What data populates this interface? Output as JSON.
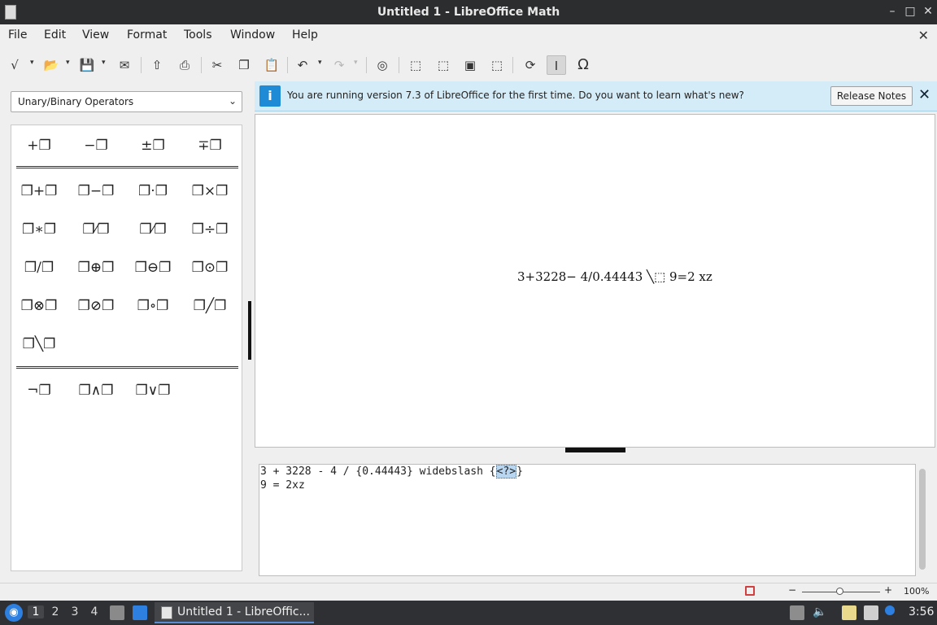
{
  "window": {
    "title": "Untitled 1 - LibreOffice Math",
    "min_glyph": "–",
    "max_glyph": "□",
    "close_glyph": "✕",
    "doc_close_glyph": "✕"
  },
  "menu": [
    "File",
    "Edit",
    "View",
    "Format",
    "Tools",
    "Window",
    "Help"
  ],
  "toolbar": {
    "icons": [
      "formula-cursor-icon",
      "open-icon",
      "save-icon",
      "export-icon",
      "print-icon",
      "cut-icon",
      "copy-icon",
      "paste-icon",
      "undo-icon",
      "redo-icon",
      "zoom-in-icon",
      "zoom-out-icon",
      "show-all-icon",
      "update-icon",
      "formula-cursor-toggle-icon",
      "symbols-icon"
    ],
    "glyphs": {
      "new": "√",
      "open": "📂",
      "save": "💾",
      "export": "✉",
      "pdf": "⇧",
      "print": "⎙",
      "cut": "✂",
      "copy": "❐",
      "paste": "📋",
      "undo": "↶",
      "redo": "↷",
      "zoom100": "◎",
      "zoomin": "⬚",
      "zoomout": "⬚",
      "showall": "▣",
      "fit": "⬚",
      "update": "⟳",
      "cursor": "I",
      "symbols": "Ω",
      "dropdown": "▾"
    }
  },
  "elements_panel": {
    "category": "Unary/Binary Operators",
    "chevron": "⌄",
    "unary": [
      "+❐",
      "−❐",
      "±❐",
      "∓❐"
    ],
    "binary_row1": [
      "❐+❐",
      "❐−❐",
      "❐·❐",
      "❐×❐"
    ],
    "binary_row2": [
      "❐∗❐",
      "❐⁄❐",
      "❐⁄❐",
      "❐÷❐"
    ],
    "binary_row3": [
      "❐/❐",
      "❐⊕❐",
      "❐⊖❐",
      "❐⊙❐"
    ],
    "binary_row4": [
      "❐⊗❐",
      "❐⊘❐",
      "❐∘❐",
      "❐╱❐"
    ],
    "binary_row5": [
      "❐╲❐"
    ],
    "logic": [
      "¬❐",
      "❐∧❐",
      "❐∨❐"
    ]
  },
  "infobar": {
    "icon": "i",
    "message": "You are running version 7.3 of LibreOffice for the first time. Do you want to learn what's new?",
    "button": "Release Notes",
    "close": "✕"
  },
  "preview": {
    "formula": "3+3228− 4/0.44443 ╲⬚ 9=2 xz"
  },
  "editor": {
    "line1_before": "3 + 3228 - 4 / {0.44443} widebslash {",
    "line1_placeholder": "<?>",
    "line1_after": "}",
    "line2": "9 = 2xz"
  },
  "statusbar": {
    "zoom_minus": "−",
    "zoom_plus": "+",
    "zoom": "100%",
    "zoom_level": 1.0
  },
  "taskbar": {
    "workspaces": [
      "1",
      "2",
      "3",
      "4"
    ],
    "task_label": "Untitled 1 - LibreOffic...",
    "clock": "3:56",
    "start_glyph": "◉"
  }
}
